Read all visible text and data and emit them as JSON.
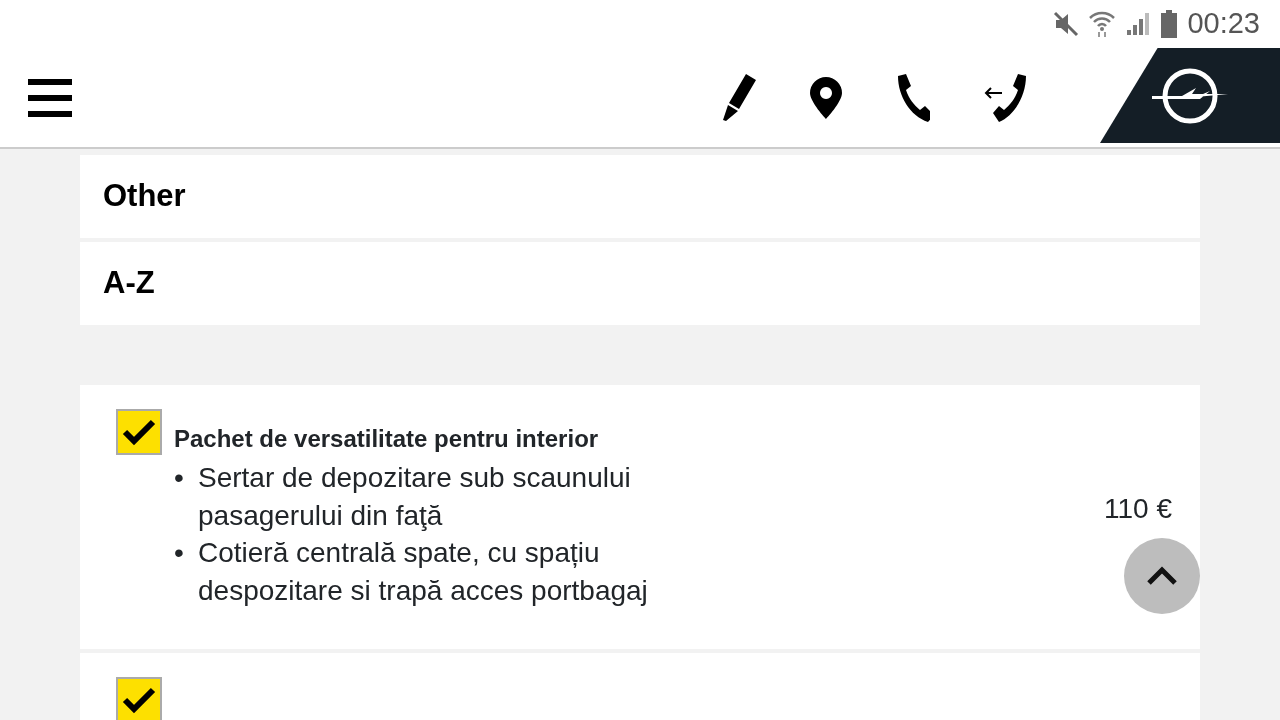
{
  "status_bar": {
    "time": "00:23"
  },
  "categories": [
    {
      "label": "Other"
    },
    {
      "label": "A-Z"
    }
  ],
  "options": [
    {
      "checked": true,
      "title": "Pachet de versatilitate pentru interior",
      "bullets": [
        {
          "marker": "•",
          "text": "Sertar de depozitare sub scaunului pasagerului din faţă"
        },
        {
          "marker": "•",
          "text": "Cotieră centrală spate, cu spațiu despozitare si trapă acces portbagaj"
        }
      ],
      "price": "110 €"
    },
    {
      "checked": true
    }
  ]
}
